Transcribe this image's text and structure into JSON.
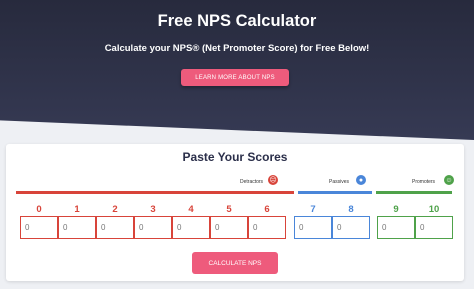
{
  "hero": {
    "title": "Free NPS Calculator",
    "subtitle": "Calculate your NPS® (Net Promoter Score) for Free Below!",
    "button_label": "LEARN MORE ABOUT NPS"
  },
  "card": {
    "title": "Paste Your Scores",
    "groups": {
      "detractors": {
        "label": "Detractors",
        "color": "#d8443a",
        "icon": "sad-face-icon"
      },
      "passives": {
        "label": "Passives",
        "color": "#4a86d9",
        "icon": "neutral-face-icon"
      },
      "promoters": {
        "label": "Promoters",
        "color": "#4fa24a",
        "icon": "happy-face-icon"
      }
    },
    "scores": [
      {
        "label": "0",
        "value": "0"
      },
      {
        "label": "1",
        "value": "0"
      },
      {
        "label": "2",
        "value": "0"
      },
      {
        "label": "3",
        "value": "0"
      },
      {
        "label": "4",
        "value": "0"
      },
      {
        "label": "5",
        "value": "0"
      },
      {
        "label": "6",
        "value": "0"
      },
      {
        "label": "7",
        "value": "0"
      },
      {
        "label": "8",
        "value": "0"
      },
      {
        "label": "9",
        "value": "0"
      },
      {
        "label": "10",
        "value": "0"
      }
    ],
    "calculate_label": "CALCULATE NPS"
  },
  "colors": {
    "accent": "#ee5b7c",
    "hero_bg": "#2d3048"
  }
}
